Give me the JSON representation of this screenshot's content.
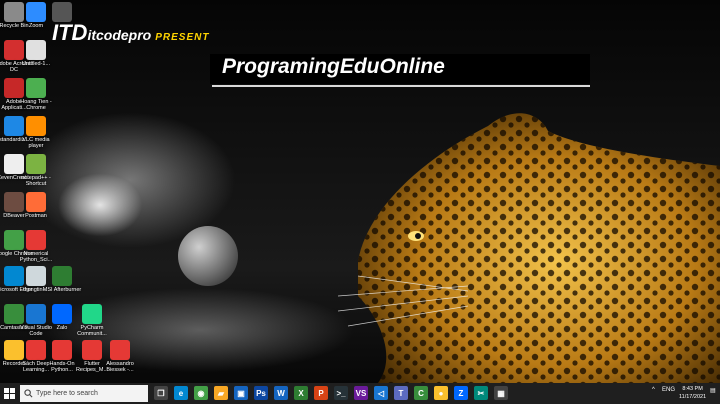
{
  "banner": {
    "brand_main": "ITD",
    "brand_sub": "itcodepro",
    "present": "PRESENT",
    "headline": "ProgramingEduOnline"
  },
  "desktop_icons": [
    {
      "label": "Recycle Bin",
      "icon": "recycle-bin-icon",
      "color": "#8a8a8a"
    },
    {
      "label": "Zoom",
      "icon": "zoom-icon",
      "color": "#2d8cff"
    },
    {
      "label": "",
      "icon": "folder-icon",
      "color": "#555555"
    },
    {
      "label": "Adobe Acrobat DC",
      "icon": "acrobat-icon",
      "color": "#d32f2f"
    },
    {
      "label": "Untitled-1...",
      "icon": "document-icon",
      "color": "#e0e0e0"
    },
    {
      "label": "Adobe Applicati...",
      "icon": "adobe-app-icon",
      "color": "#c62828"
    },
    {
      "label": "Hoang Tien - Chrome",
      "icon": "chrome-icon",
      "color": "#4caf50"
    },
    {
      "label": "standardiz...",
      "icon": "edge-icon",
      "color": "#1e88e5"
    },
    {
      "label": "VLC media player",
      "icon": "vlc-icon",
      "color": "#ff8f00"
    },
    {
      "label": "CevenCreat...",
      "icon": "app-icon",
      "color": "#eeeeee"
    },
    {
      "label": "notepad++ - Shortcut",
      "icon": "notepad-icon",
      "color": "#7cb342"
    },
    {
      "label": "DBeaver",
      "icon": "dbeaver-icon",
      "color": "#6d4c41"
    },
    {
      "label": "Postman",
      "icon": "postman-icon",
      "color": "#ff6c37"
    },
    {
      "label": "Google Chrome",
      "icon": "chrome-icon",
      "color": "#43a047"
    },
    {
      "label": "Numerical Python_Sci...",
      "icon": "pdf-icon",
      "color": "#e53935"
    },
    {
      "label": "Microsoft Edge",
      "icon": "edge-icon",
      "color": "#0288d1"
    },
    {
      "label": "thongtin-...",
      "icon": "document-icon",
      "color": "#cfd8dc"
    },
    {
      "label": "MSI Afterburner",
      "icon": "msi-icon",
      "color": "#2e7d32"
    },
    {
      "label": "Camtasia 9",
      "icon": "camtasia-icon",
      "color": "#388e3c"
    },
    {
      "label": "Visual Studio Code",
      "icon": "vscode-icon",
      "color": "#1976d2"
    },
    {
      "label": "Zalo",
      "icon": "zalo-icon",
      "color": "#0068ff"
    },
    {
      "label": "PyCharm Communit...",
      "icon": "pycharm-icon",
      "color": "#21d789"
    },
    {
      "label": "Recorder",
      "icon": "recorder-icon",
      "color": "#fbc02d"
    },
    {
      "label": "Sách Deep Learning...",
      "icon": "pdf-icon",
      "color": "#e53935"
    },
    {
      "label": "Hands-On Python...",
      "icon": "pdf-icon",
      "color": "#e53935"
    },
    {
      "label": "Flutter Recipes_M...",
      "icon": "pdf-icon",
      "color": "#e53935"
    },
    {
      "label": "Alessandro Biessek -...",
      "icon": "pdf-icon",
      "color": "#e53935"
    }
  ],
  "taskbar": {
    "search_placeholder": "Type here to search",
    "apps": [
      {
        "icon": "task-view-icon",
        "color": "#444444",
        "glyph": "❐"
      },
      {
        "icon": "edge-icon",
        "color": "#0288d1",
        "glyph": "e"
      },
      {
        "icon": "chrome-icon",
        "color": "#43a047",
        "glyph": "◉"
      },
      {
        "icon": "file-explorer-icon",
        "color": "#f9a825",
        "glyph": "▰"
      },
      {
        "icon": "store-icon",
        "color": "#1565c0",
        "glyph": "▣"
      },
      {
        "icon": "photoshop-icon",
        "color": "#0d47a1",
        "glyph": "Ps"
      },
      {
        "icon": "word-icon",
        "color": "#1565c0",
        "glyph": "W"
      },
      {
        "icon": "excel-icon",
        "color": "#2e7d32",
        "glyph": "X"
      },
      {
        "icon": "powerpoint-icon",
        "color": "#d84315",
        "glyph": "P"
      },
      {
        "icon": "terminal-icon",
        "color": "#263238",
        "glyph": ">_"
      },
      {
        "icon": "visual-studio-icon",
        "color": "#6a1b9a",
        "glyph": "VS"
      },
      {
        "icon": "vscode-icon",
        "color": "#1976d2",
        "glyph": "◁"
      },
      {
        "icon": "teams-icon",
        "color": "#5c6bc0",
        "glyph": "T"
      },
      {
        "icon": "camtasia-icon",
        "color": "#388e3c",
        "glyph": "C"
      },
      {
        "icon": "recorder-icon",
        "color": "#fbc02d",
        "glyph": "●"
      },
      {
        "icon": "zalo-icon",
        "color": "#0068ff",
        "glyph": "Z"
      },
      {
        "icon": "snipping-icon",
        "color": "#00897b",
        "glyph": "✂"
      },
      {
        "icon": "app-icon",
        "color": "#424242",
        "glyph": "▦"
      }
    ],
    "tray": {
      "lang": "ENG",
      "time": "8:43 PM",
      "date": "11/17/2021"
    }
  }
}
